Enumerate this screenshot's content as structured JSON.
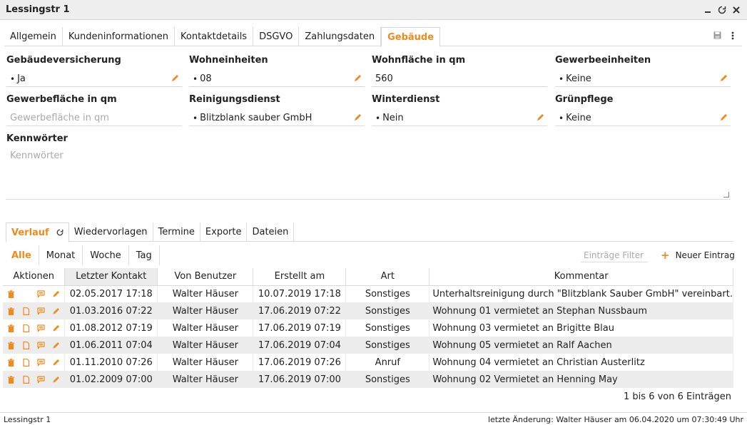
{
  "window": {
    "title": "Lessingstr 1"
  },
  "tabs": [
    {
      "label": "Allgemein"
    },
    {
      "label": "Kundeninformationen"
    },
    {
      "label": "Kontaktdetails"
    },
    {
      "label": "DSGVO"
    },
    {
      "label": "Zahlungsdaten"
    },
    {
      "label": "Gebäude",
      "active": true
    }
  ],
  "fields": {
    "versicherung": {
      "label": "Gebäudeversicherung",
      "value": "Ja"
    },
    "wohneinheiten": {
      "label": "Wohneinheiten",
      "value": "08"
    },
    "wohnflaeche": {
      "label": "Wohnfläche in qm",
      "value": "560"
    },
    "gewerbeeinheiten": {
      "label": "Gewerbeeinheiten",
      "value": "Keine"
    },
    "gewerbeflaeche": {
      "label": "Gewerbefläche in qm",
      "placeholder": "Gewerbefläche in qm"
    },
    "reinigung": {
      "label": "Reinigungsdienst",
      "value": "Blitzblank sauber GmbH"
    },
    "winterdienst": {
      "label": "Winterdienst",
      "value": "Nein"
    },
    "gruenpflege": {
      "label": "Grünpflege",
      "value": "Keine"
    },
    "kennwoerter": {
      "label": "Kennwörter",
      "placeholder": "Kennwörter"
    }
  },
  "bottom_tabs": [
    {
      "label": "Verlauf",
      "active": true
    },
    {
      "label": "Wiedervorlagen"
    },
    {
      "label": "Termine"
    },
    {
      "label": "Exporte"
    },
    {
      "label": "Dateien"
    }
  ],
  "subtabs": [
    {
      "label": "Alle",
      "active": true
    },
    {
      "label": "Monat"
    },
    {
      "label": "Woche"
    },
    {
      "label": "Tag"
    }
  ],
  "filter": {
    "placeholder": "Einträge Filter"
  },
  "new_entry": {
    "label": "Neuer Eintrag"
  },
  "table": {
    "headers": [
      "Aktionen",
      "Letzter Kontakt",
      "Von Benutzer",
      "Erstellt am",
      "Art",
      "Kommentar"
    ],
    "rows": [
      {
        "last": "02.05.2017 17:18",
        "user": "Walter Häuser",
        "created": "10.07.2019 17:18",
        "type": "Sonstiges",
        "comment": "Unterhaltsreinigung durch \"Blitzblank Sauber GmbH\" vereinbart."
      },
      {
        "last": "01.03.2016 07:22",
        "user": "Walter Häuser",
        "created": "17.06.2019 07:22",
        "type": "Sonstiges",
        "comment": "Wohnung 01 vermietet an Stephan Nussbaum"
      },
      {
        "last": "01.08.2012 07:19",
        "user": "Walter Häuser",
        "created": "17.06.2019 07:19",
        "type": "Sonstiges",
        "comment": "Wohnung 03 vermietet an Brigitte Blau"
      },
      {
        "last": "01.06.2011 07:04",
        "user": "Walter Häuser",
        "created": "17.06.2019 07:04",
        "type": "Sonstiges",
        "comment": "Wohnung 05 vermietet an Ralf Aachen"
      },
      {
        "last": "01.11.2010 07:26",
        "user": "Walter Häuser",
        "created": "17.06.2019 07:26",
        "type": "Anruf",
        "comment": "Wohnung 04 vermietet an Christian Austerlitz"
      },
      {
        "last": "01.02.2009 07:00",
        "user": "Walter Häuser",
        "created": "17.06.2019 07:00",
        "type": "Sonstiges",
        "comment": "Wohnung 02 Vermietet an Henning May"
      }
    ]
  },
  "pager": {
    "text": "1 bis 6 von 6 Einträgen"
  },
  "status": {
    "left": "Lessingstr 1",
    "right": "letzte Änderung: Walter Häuser am 06.04.2020 um 07:30:49 Uhr"
  },
  "colors": {
    "accent": "#f08a1c"
  }
}
